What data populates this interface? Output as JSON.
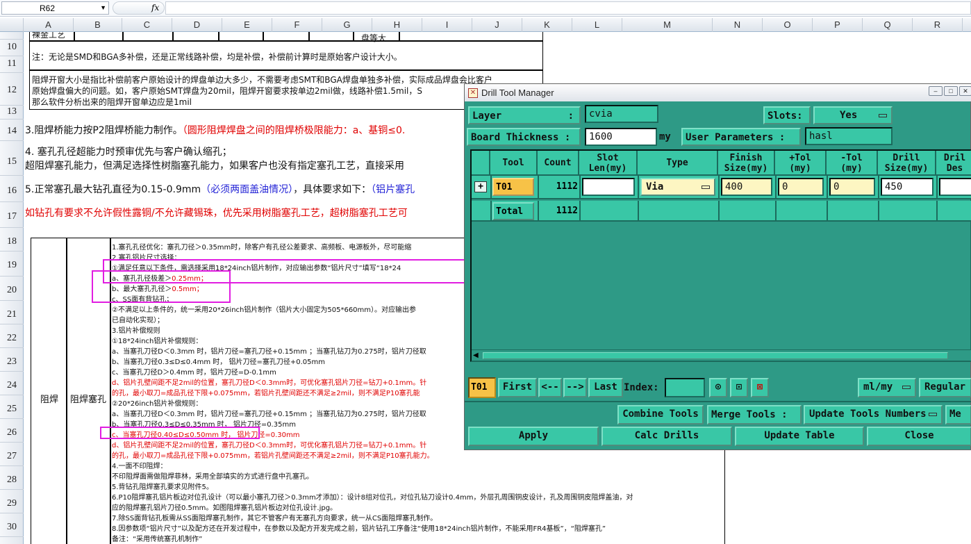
{
  "formula_bar": {
    "cell_ref": "R62",
    "fx": "fx",
    "content": ""
  },
  "columns": [
    "A",
    "B",
    "C",
    "D",
    "E",
    "F",
    "G",
    "H",
    "I",
    "J",
    "K",
    "L",
    "M",
    "N",
    "O",
    "P",
    "Q",
    "R"
  ],
  "rows": [
    "10",
    "11",
    "12",
    "13",
    "14",
    "15",
    "16",
    "17",
    "18",
    "19",
    "20",
    "21",
    "22",
    "23",
    "24",
    "25",
    "26",
    "27",
    "28",
    "29",
    "30"
  ],
  "sheet": {
    "top_partial_left": "裸金工艺",
    "top_partial_mid": "盘等大",
    "r10": "注：无论是SMD和BGA多补偿，还是正常线路补偿，均是补偿，补偿前计算时是原始客户设计大小。",
    "r12a": "阻焊开窗大小是指比补偿前客户原始设计的焊盘单边大多少，不需要考虑SMT和BGA焊盘单独多补偿，实际成品焊盘会比客户",
    "r12b": "原始焊盘偏大的问题。如，客户原始SMT焊盘为20mil，阻焊开窗要求按单边2mil做，线路补偿1.5mil，S",
    "r12c": "那么软件分析出来的阻焊开窗单边应是1mil",
    "r14_black": "3.阻焊桥能力按P2阻焊桥能力制作。",
    "r14_red": "（圆形阻焊焊盘之间的阻焊桥极限能力：a、基铜≤0.",
    "r15a": "4. 塞孔孔径超能力时预审优先与客户确认缩孔；",
    "r15b": "超阻焊塞孔能力，但满足选择性树脂塞孔能力，如果客户也没有指定塞孔工艺，直接采用",
    "r16_black": "5.正常塞孔最大钻孔直径为0.15-0.9mm",
    "r16_blue": "（必须两面盖油情况）",
    "r16_black2": "，具体要求如下：",
    "r16_blue2": "（铝片塞孔",
    "r17_red": "如钻孔有要求不允许假性露铜/不允许藏锡珠，优先采用树脂塞孔工艺，超树脂塞孔工艺可",
    "cell_a": "阻焊",
    "cell_b": "阻焊塞孔",
    "lines": [
      {
        "t": "1.塞孔孔径优化：塞孔刀径＞0.35mm时，除客户有孔径公差要求、高频板、电源板外，尽可能缩",
        "c": "k"
      },
      {
        "t": "2.塞孔铝片尺寸选择：",
        "c": "k"
      },
      {
        "t": "①满足任意以下条件，需选择采用18*24inch铝片制作，对应输出参数“铝片尺寸”填写“18*24",
        "c": "k"
      },
      {
        "t": "a、塞孔孔径极差＞0.25mm；",
        "c": "k",
        "r": "0.25mm；"
      },
      {
        "t": "b、最大塞孔孔径＞0.5mm；",
        "c": "k",
        "r": "0.5mm；"
      },
      {
        "t": "c、SS面有背钻孔；",
        "c": "k"
      },
      {
        "t": "②不满足以上条件的，统一采用20*26inch铝片制作（铝片大小固定为505*660mm）。对应输出参",
        "c": "k"
      },
      {
        "t": "已自动化实现）；",
        "c": "k"
      },
      {
        "t": "3.铝片补偿规则",
        "c": "k"
      },
      {
        "t": "①18*24inch铝片补偿规则：",
        "c": "k"
      },
      {
        "t": "a、当塞孔刀径D＜0.3mm 时，铝片刀径=塞孔刀径+0.15mm ；当塞孔钻刀为0.275时，铝片刀径取",
        "c": "k"
      },
      {
        "t": "b、当塞孔刀径0.3≤D≤0.4mm 时， 铝片刀径=塞孔刀径+0.05mm",
        "c": "k"
      },
      {
        "t": "c、当塞孔刀径D＞0.4mm 时，铝片刀径=D-0.1mm",
        "c": "k"
      },
      {
        "t": "d、铝片孔壁间距不足2mil的位置，塞孔刀径D＜0.3mm时，可优化塞孔铝片刀径=钻刀+0.1mm。针",
        "c": "r"
      },
      {
        "t": "的孔，最小取刀=成品孔径下限+0.075mm，若铝片孔壁间距还不满足≥2mil，则不满足P10塞孔能",
        "c": "r"
      },
      {
        "t": "②20*26inch铝片补偿规则：",
        "c": "k"
      },
      {
        "t": "a、当塞孔刀径D＜0.3mm 时，铝片刀径=塞孔刀径+0.15mm ；当塞孔钻刀为0.275时，铝片刀径取",
        "c": "k"
      },
      {
        "t": "b、当塞孔刀径0.3≤D≤0.35mm 时， 铝片刀径=0.35mm",
        "c": "k"
      },
      {
        "t": "c、当塞孔刀径0.40≤D≤0.50mm 时， 铝片刀径=0.30mm",
        "c": "r"
      },
      {
        "t": "d、铝片孔壁间距不足2mil的位置，塞孔刀径D＜0.3mm时，可优化塞孔铝片刀径=钻刀+0.1mm。针",
        "c": "r"
      },
      {
        "t": "的孔，最小取刀=成品孔径下限+0.075mm，若铝片孔壁间距还不满足≥2mil，则不满足P10塞孔能力。",
        "c": "r"
      },
      {
        "t": "4.一面不印阻焊：",
        "c": "k"
      },
      {
        "t": "不印阻焊面需做阻焊菲林，采用全部填实的方式进行盘中孔塞孔。",
        "c": "k"
      },
      {
        "t": "5.背钻孔阻焊塞孔要求见附件5。",
        "c": "k"
      },
      {
        "t": "6.P10阻焊塞孔铝片板边对位孔设计（可以最小塞孔刀径＞0.3mm才添加）：设计8组对位孔，对位孔钻刀设计0.4mm，外层孔周围铜皮设计，孔及周围铜皮阻焊盖油，对",
        "c": "k"
      },
      {
        "t": "应的阻焊塞孔铝片刀径0.5mm。如图阻焊塞孔铝片板边对位孔设计.jpg。",
        "c": "k"
      },
      {
        "t": "7.除SS面背钻孔板需从SS面阻焊塞孔制作，其它不管客户有无塞孔方向要求，统一从CS面阻焊塞孔制作。",
        "c": "k"
      },
      {
        "t": "8.因参数项“铝片尺寸”以及配方还在开发过程中，在参数以及配方开发完成之前，铝片钻孔工序备注“使用18*24inch铝片制作，不能采用FR4基板”，“阻焊塞孔”",
        "c": "k"
      },
      {
        "t": "备注：“采用传统塞孔机制作”",
        "c": "k"
      }
    ]
  },
  "dialog": {
    "title": "Drill Tool Manager",
    "layer_label": "Layer",
    "layer_colon": ":",
    "layer_value": "cvia",
    "slots_label": "Slots:",
    "slots_value": "Yes",
    "thickness_label": "Board Thickness :",
    "thickness_value": "1600",
    "thickness_unit": "my",
    "user_params_label": "User Parameters :",
    "user_params_value": "hasl",
    "headers": [
      "Tool",
      "Count",
      "Slot\nLen(my)",
      "Type",
      "Finish\nSize(my)",
      "+Tol\n(my)",
      "-Tol\n(my)",
      "Drill\nSize(my)",
      "Dril\nDes"
    ],
    "row1": {
      "expand": "+",
      "tool": "T01",
      "count": "1112",
      "slot_len": "",
      "type": "Via",
      "finish": "400",
      "plus_tol": "0",
      "minus_tol": "0",
      "drill": "450",
      "desc": ""
    },
    "row2": {
      "tool": "Total",
      "count": "1112"
    },
    "nav": {
      "current": "T01",
      "first": "First",
      "prev": "<--",
      "next": "-->",
      "last": "Last",
      "index_label": "Index:",
      "index_value": "",
      "unit": "ml/my",
      "mode": "Regular"
    },
    "combine": "Combine Tools",
    "merge": "Merge Tools :",
    "update_numbers": "Update Tools Numbers",
    "me": "Me",
    "apply": "Apply",
    "calc": "Calc Drills",
    "update_table": "Update Table",
    "close": "Close"
  },
  "colors": {
    "teal": "#2e9a86",
    "teal_light": "#39c7a6",
    "tool_yellow": "#f7c247",
    "highlight": "#e11de1",
    "red_text": "#e00000"
  }
}
